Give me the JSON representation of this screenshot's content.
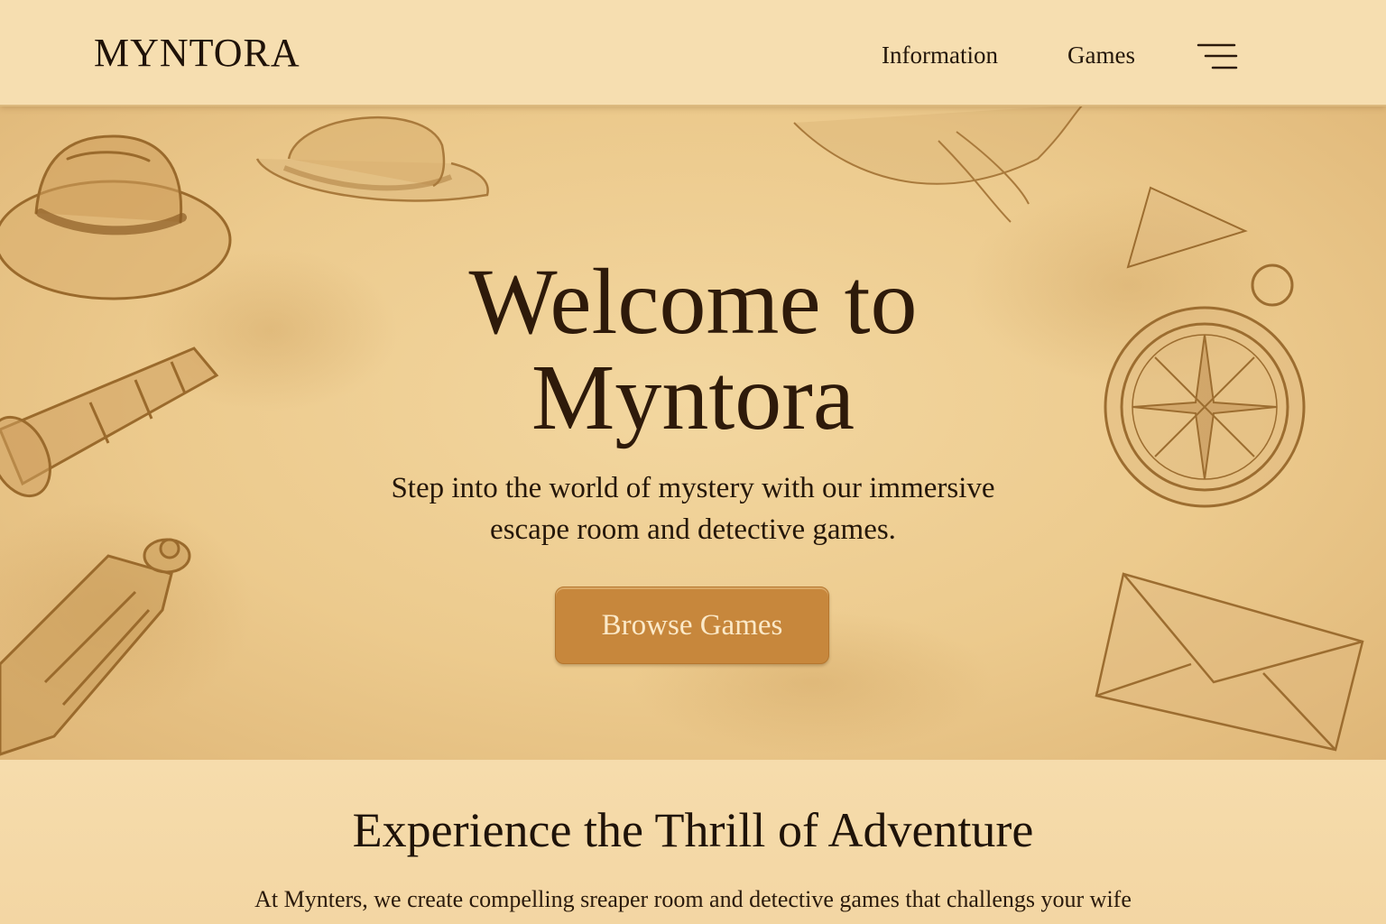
{
  "header": {
    "logo": "MYNTORA",
    "nav": [
      {
        "label": "Information"
      },
      {
        "label": "Games"
      }
    ],
    "menu_icon": "hamburger-menu-icon"
  },
  "hero": {
    "title_line1": "Welcome to",
    "title_line2": "Myntora",
    "subtitle_line1": "Step into the world of mystery with our immersive",
    "subtitle_line2": "escape room and detective games.",
    "cta_label": "Browse Games",
    "decor_icons": [
      "fedora-hat-icon",
      "bowler-hat-icon",
      "spyglass-icon",
      "telescope-icon",
      "compass-icon",
      "envelope-icon",
      "map-icon"
    ]
  },
  "about": {
    "title": "Experience the Thrill of Adventure",
    "body": "At Mynters, we create compelling sreaper room and detective games that challengs your wife"
  },
  "colors": {
    "parchment": "#f1d6a3",
    "header_bg": "#f6deb0",
    "button": "#c7873c",
    "button_text": "#fbe9c8",
    "ink": "#2e1a0a"
  }
}
